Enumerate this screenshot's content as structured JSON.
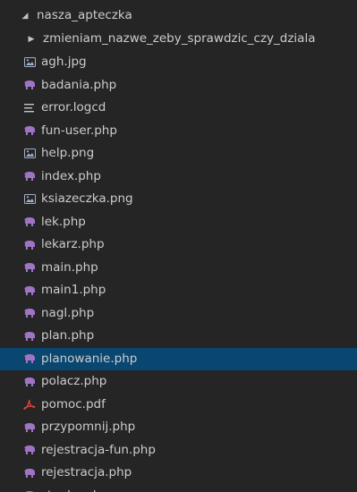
{
  "explorer": {
    "root": {
      "name": "nasza_apteczka",
      "expanded": true,
      "chevron_icon": "triangle-down-icon"
    },
    "subfolder": {
      "name": "zmieniam_nazwe_zeby_sprawdzic_czy_dziala",
      "expanded": false,
      "chevron_icon": "triangle-right-icon"
    },
    "files": [
      {
        "name": "agh.jpg",
        "icon": "image-file-icon"
      },
      {
        "name": "badania.php",
        "icon": "php-elephant-icon"
      },
      {
        "name": "error.logcd",
        "icon": "text-file-icon"
      },
      {
        "name": "fun-user.php",
        "icon": "php-elephant-icon"
      },
      {
        "name": "help.png",
        "icon": "image-file-icon"
      },
      {
        "name": "index.php",
        "icon": "php-elephant-icon"
      },
      {
        "name": "ksiazeczka.png",
        "icon": "image-file-icon"
      },
      {
        "name": "lek.php",
        "icon": "php-elephant-icon"
      },
      {
        "name": "lekarz.php",
        "icon": "php-elephant-icon"
      },
      {
        "name": "main.php",
        "icon": "php-elephant-icon"
      },
      {
        "name": "main1.php",
        "icon": "php-elephant-icon"
      },
      {
        "name": "nagl.php",
        "icon": "php-elephant-icon"
      },
      {
        "name": "plan.php",
        "icon": "php-elephant-icon"
      },
      {
        "name": "planowanie.php",
        "icon": "php-elephant-icon",
        "selected": true
      },
      {
        "name": "polacz.php",
        "icon": "php-elephant-icon"
      },
      {
        "name": "pomoc.pdf",
        "icon": "pdf-file-icon"
      },
      {
        "name": "przypomnij.php",
        "icon": "php-elephant-icon"
      },
      {
        "name": "rejestracja-fun.php",
        "icon": "php-elephant-icon"
      },
      {
        "name": "rejestracja.php",
        "icon": "php-elephant-icon"
      },
      {
        "name": "stopka.php",
        "icon": "php-elephant-icon"
      }
    ]
  },
  "colors": {
    "background": "#252526",
    "text": "#cccccc",
    "selection": "#094771",
    "php_icon": "#a074c4",
    "image_icon": "#a0b0c6",
    "pdf_icon": "#e0443c"
  }
}
